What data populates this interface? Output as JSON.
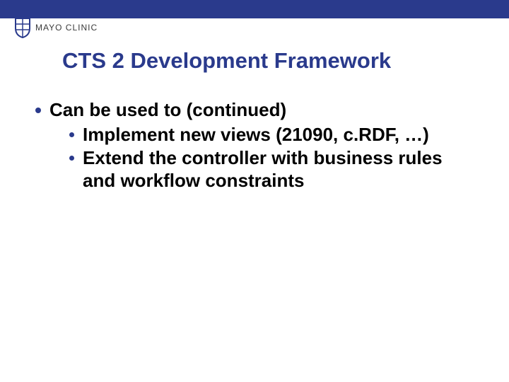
{
  "header": {
    "brand_name": "MAYO CLINIC"
  },
  "title": "CTS 2 Development Framework",
  "content": {
    "main_item": "Can be used to (continued)",
    "sub_items": [
      "Implement new views (21090, c.RDF, …)",
      "Extend the controller with business rules and workflow constraints"
    ]
  },
  "colors": {
    "brand_blue": "#2a3a8c"
  }
}
